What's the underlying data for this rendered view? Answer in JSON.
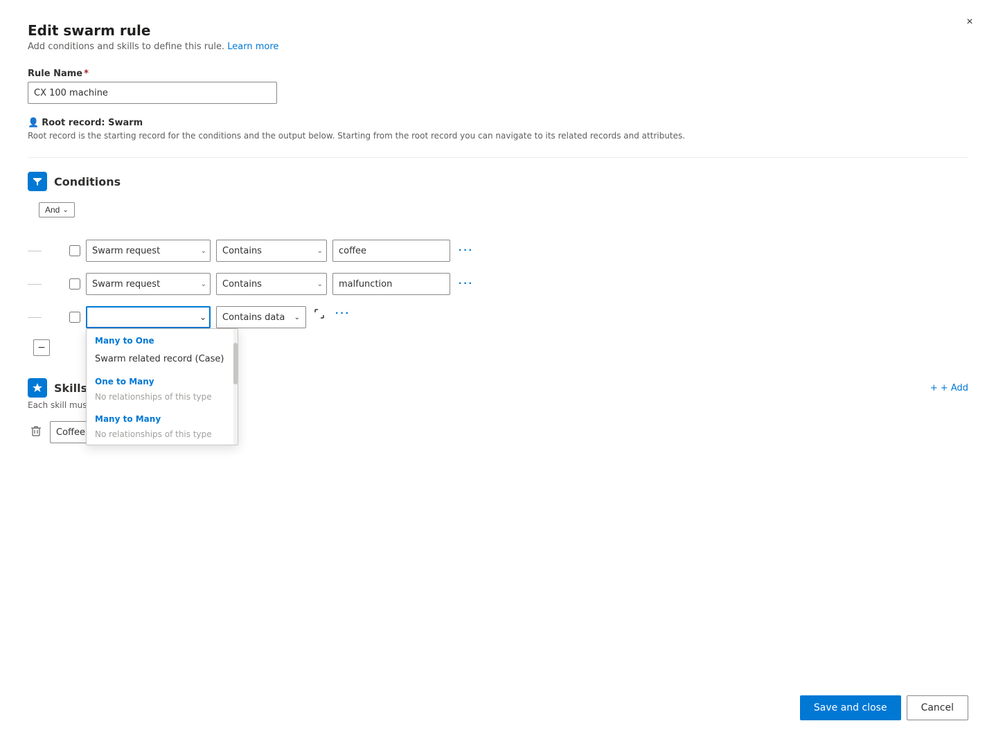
{
  "modal": {
    "title": "Edit swarm rule",
    "subtitle": "Add conditions and skills to define this rule.",
    "learn_more": "Learn more",
    "close_label": "×"
  },
  "rule_name": {
    "label": "Rule Name",
    "required": "*",
    "value": "CX 100 machine"
  },
  "root_record": {
    "label": "Root record: Swarm",
    "description": "Root record is the starting record for the conditions and the output below. Starting from the root record you can navigate to its related records and attributes."
  },
  "conditions": {
    "section_title": "Conditions",
    "and_label": "And",
    "rows": [
      {
        "field": "Swarm request",
        "operator": "Contains",
        "value": "coffee"
      },
      {
        "field": "Swarm request",
        "operator": "Contains",
        "value": "malfunction"
      },
      {
        "field": "",
        "operator": "Contains data",
        "value": ""
      }
    ],
    "dropdown": {
      "many_to_one_label": "Many to One",
      "swarm_related": "Swarm related record (Case)",
      "one_to_many_label": "One to Many",
      "no_one_to_many": "No relationships of this type",
      "many_to_many_label": "Many to Many",
      "no_many_to_many": "No relationships of this type"
    }
  },
  "skills": {
    "section_title": "Skills",
    "description": "Each skill must be unique.",
    "add_label": "+ Add",
    "rows": [
      {
        "value": "Coffee machine hardware"
      }
    ]
  },
  "footer": {
    "save_label": "Save and close",
    "cancel_label": "Cancel"
  }
}
